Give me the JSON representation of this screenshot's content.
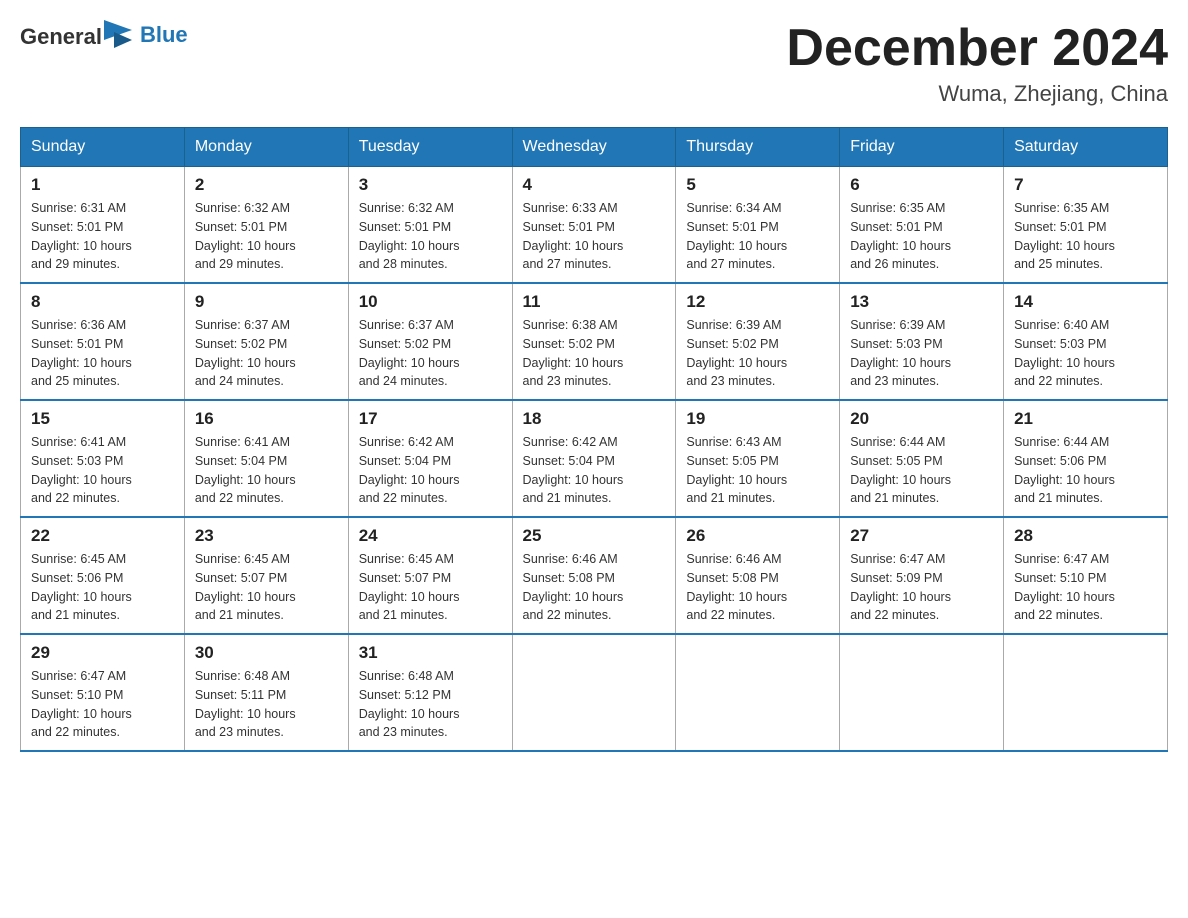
{
  "header": {
    "logo_general": "General",
    "logo_blue": "Blue",
    "month_title": "December 2024",
    "location": "Wuma, Zhejiang, China"
  },
  "weekdays": [
    "Sunday",
    "Monday",
    "Tuesday",
    "Wednesday",
    "Thursday",
    "Friday",
    "Saturday"
  ],
  "weeks": [
    [
      {
        "day": "1",
        "sunrise": "6:31 AM",
        "sunset": "5:01 PM",
        "daylight": "10 hours and 29 minutes."
      },
      {
        "day": "2",
        "sunrise": "6:32 AM",
        "sunset": "5:01 PM",
        "daylight": "10 hours and 29 minutes."
      },
      {
        "day": "3",
        "sunrise": "6:32 AM",
        "sunset": "5:01 PM",
        "daylight": "10 hours and 28 minutes."
      },
      {
        "day": "4",
        "sunrise": "6:33 AM",
        "sunset": "5:01 PM",
        "daylight": "10 hours and 27 minutes."
      },
      {
        "day": "5",
        "sunrise": "6:34 AM",
        "sunset": "5:01 PM",
        "daylight": "10 hours and 27 minutes."
      },
      {
        "day": "6",
        "sunrise": "6:35 AM",
        "sunset": "5:01 PM",
        "daylight": "10 hours and 26 minutes."
      },
      {
        "day": "7",
        "sunrise": "6:35 AM",
        "sunset": "5:01 PM",
        "daylight": "10 hours and 25 minutes."
      }
    ],
    [
      {
        "day": "8",
        "sunrise": "6:36 AM",
        "sunset": "5:01 PM",
        "daylight": "10 hours and 25 minutes."
      },
      {
        "day": "9",
        "sunrise": "6:37 AM",
        "sunset": "5:02 PM",
        "daylight": "10 hours and 24 minutes."
      },
      {
        "day": "10",
        "sunrise": "6:37 AM",
        "sunset": "5:02 PM",
        "daylight": "10 hours and 24 minutes."
      },
      {
        "day": "11",
        "sunrise": "6:38 AM",
        "sunset": "5:02 PM",
        "daylight": "10 hours and 23 minutes."
      },
      {
        "day": "12",
        "sunrise": "6:39 AM",
        "sunset": "5:02 PM",
        "daylight": "10 hours and 23 minutes."
      },
      {
        "day": "13",
        "sunrise": "6:39 AM",
        "sunset": "5:03 PM",
        "daylight": "10 hours and 23 minutes."
      },
      {
        "day": "14",
        "sunrise": "6:40 AM",
        "sunset": "5:03 PM",
        "daylight": "10 hours and 22 minutes."
      }
    ],
    [
      {
        "day": "15",
        "sunrise": "6:41 AM",
        "sunset": "5:03 PM",
        "daylight": "10 hours and 22 minutes."
      },
      {
        "day": "16",
        "sunrise": "6:41 AM",
        "sunset": "5:04 PM",
        "daylight": "10 hours and 22 minutes."
      },
      {
        "day": "17",
        "sunrise": "6:42 AM",
        "sunset": "5:04 PM",
        "daylight": "10 hours and 22 minutes."
      },
      {
        "day": "18",
        "sunrise": "6:42 AM",
        "sunset": "5:04 PM",
        "daylight": "10 hours and 21 minutes."
      },
      {
        "day": "19",
        "sunrise": "6:43 AM",
        "sunset": "5:05 PM",
        "daylight": "10 hours and 21 minutes."
      },
      {
        "day": "20",
        "sunrise": "6:44 AM",
        "sunset": "5:05 PM",
        "daylight": "10 hours and 21 minutes."
      },
      {
        "day": "21",
        "sunrise": "6:44 AM",
        "sunset": "5:06 PM",
        "daylight": "10 hours and 21 minutes."
      }
    ],
    [
      {
        "day": "22",
        "sunrise": "6:45 AM",
        "sunset": "5:06 PM",
        "daylight": "10 hours and 21 minutes."
      },
      {
        "day": "23",
        "sunrise": "6:45 AM",
        "sunset": "5:07 PM",
        "daylight": "10 hours and 21 minutes."
      },
      {
        "day": "24",
        "sunrise": "6:45 AM",
        "sunset": "5:07 PM",
        "daylight": "10 hours and 21 minutes."
      },
      {
        "day": "25",
        "sunrise": "6:46 AM",
        "sunset": "5:08 PM",
        "daylight": "10 hours and 22 minutes."
      },
      {
        "day": "26",
        "sunrise": "6:46 AM",
        "sunset": "5:08 PM",
        "daylight": "10 hours and 22 minutes."
      },
      {
        "day": "27",
        "sunrise": "6:47 AM",
        "sunset": "5:09 PM",
        "daylight": "10 hours and 22 minutes."
      },
      {
        "day": "28",
        "sunrise": "6:47 AM",
        "sunset": "5:10 PM",
        "daylight": "10 hours and 22 minutes."
      }
    ],
    [
      {
        "day": "29",
        "sunrise": "6:47 AM",
        "sunset": "5:10 PM",
        "daylight": "10 hours and 22 minutes."
      },
      {
        "day": "30",
        "sunrise": "6:48 AM",
        "sunset": "5:11 PM",
        "daylight": "10 hours and 23 minutes."
      },
      {
        "day": "31",
        "sunrise": "6:48 AM",
        "sunset": "5:12 PM",
        "daylight": "10 hours and 23 minutes."
      },
      null,
      null,
      null,
      null
    ]
  ],
  "labels": {
    "sunrise": "Sunrise:",
    "sunset": "Sunset:",
    "daylight": "Daylight:"
  }
}
